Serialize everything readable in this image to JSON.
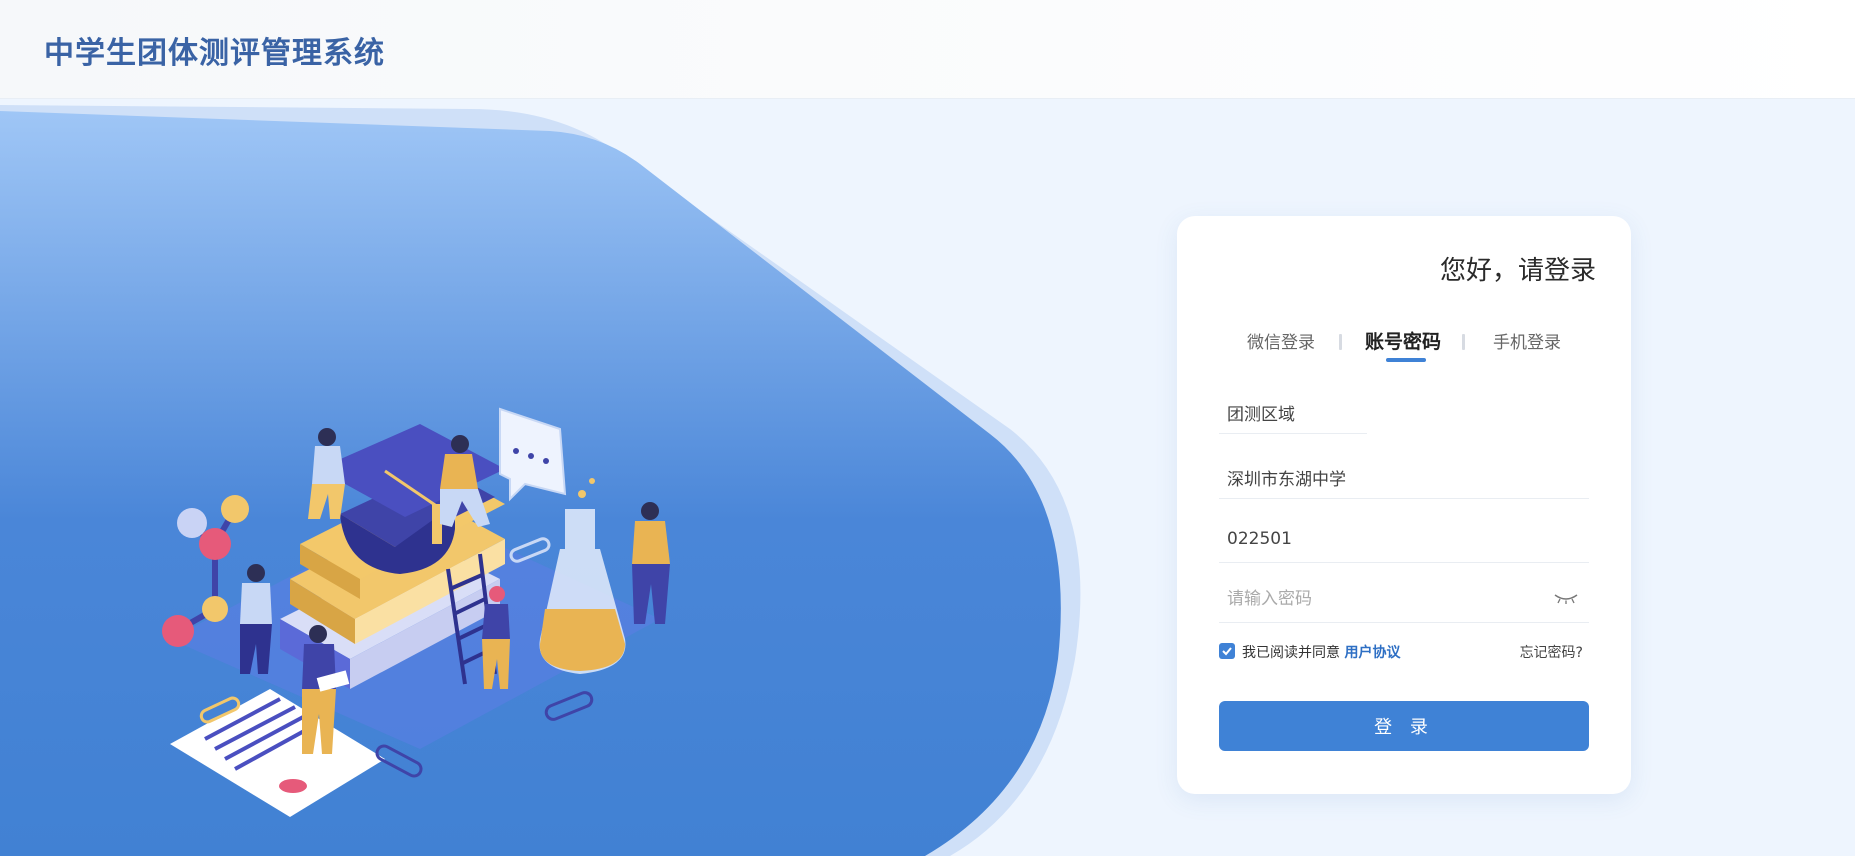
{
  "header": {
    "title": "中学生团体测评管理系统"
  },
  "login": {
    "greeting": "您好，请登录",
    "tabs": [
      {
        "label": "微信登录"
      },
      {
        "label": "账号密码"
      },
      {
        "label": "手机登录"
      }
    ],
    "active_tab": "账号密码",
    "fields": {
      "region": "团测区域",
      "school": "深圳市东湖中学",
      "account": "022501",
      "password_placeholder": "请输入密码"
    },
    "agreement": {
      "checked": true,
      "text": "我已阅读并同意",
      "link": "用户协议"
    },
    "forgot": "忘记密码?",
    "submit": "登 录"
  },
  "colors": {
    "brand": "#3a63a5",
    "accent": "#3f82d6",
    "background": "#eef5fe"
  },
  "icons": [
    "eye-closed-icon",
    "checkbox-check-icon"
  ]
}
